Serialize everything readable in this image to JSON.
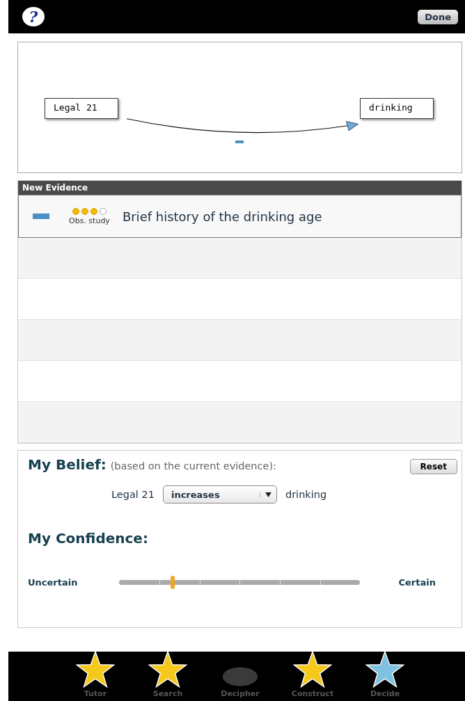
{
  "top_bar": {
    "help": "?",
    "done": "Done"
  },
  "diagram": {
    "nodes": [
      "Legal 21",
      "drinking"
    ],
    "link_negative": true
  },
  "evidence": {
    "title": "New Evidence",
    "items": [
      {
        "negative": true,
        "stars": 3,
        "type": "Obs. study",
        "title": "Brief history of the drinking age"
      }
    ]
  },
  "belief": {
    "title": "My Belief:",
    "note": "(based on the current evidence):",
    "reset": "Reset",
    "cause": "Legal 21",
    "relation": "increases",
    "effect": "drinking"
  },
  "confidence": {
    "title": "My Confidence:",
    "low": "Uncertain",
    "high": "Certain",
    "level": 0.22
  },
  "nav": [
    {
      "label": "Tutor",
      "color": "#f5c81c"
    },
    {
      "label": "Search",
      "color": "#f5c81c"
    },
    {
      "label": "Decipher"
    },
    {
      "label": "Construct",
      "color": "#f5c81c"
    },
    {
      "label": "Decide",
      "color": "#7fc1e0"
    }
  ]
}
